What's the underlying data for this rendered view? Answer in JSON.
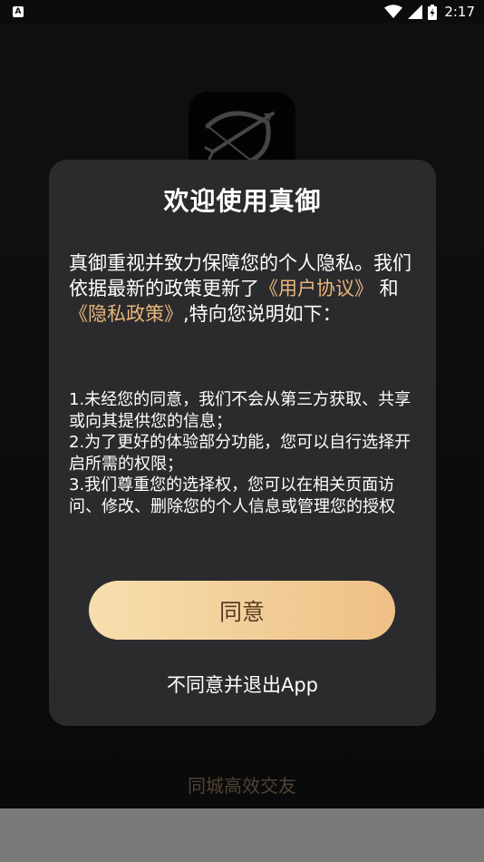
{
  "status_bar": {
    "notification_icon_label": "A",
    "time": "2:17",
    "icons": [
      "wifi-icon",
      "cell-signal-icon",
      "battery-icon"
    ]
  },
  "background_app": {
    "tagline": "同城高效交友",
    "logo_icon": "bow-and-arrow-icon"
  },
  "dialog": {
    "title": "欢迎使用真御",
    "intro_part1": "真御重视并致力保障您的个人隐私。我们依据最新的政策更新了",
    "user_agreement_link": "《用户协议》",
    "and_text": " 和 ",
    "privacy_policy_link": "《隐私政策》",
    "intro_part2": ",特向您说明如下：",
    "point1": "1.未经您的同意，我们不会从第三方获取、共享或向其提供您的信息；",
    "point2": "2.为了更好的体验部分功能，您可以自行选择开启所需的权限；",
    "point3": "3.我们尊重您的选择权，您可以在相关页面访问、修改、删除您的个人信息或管理您的授权",
    "agree_label": "同意",
    "disagree_label": "不同意并退出App"
  },
  "colors": {
    "link": "#e8b67a",
    "button_gradient_start": "#f6dfae",
    "button_gradient_end": "#efc086",
    "dialog_bg": "#2b2b2e"
  }
}
